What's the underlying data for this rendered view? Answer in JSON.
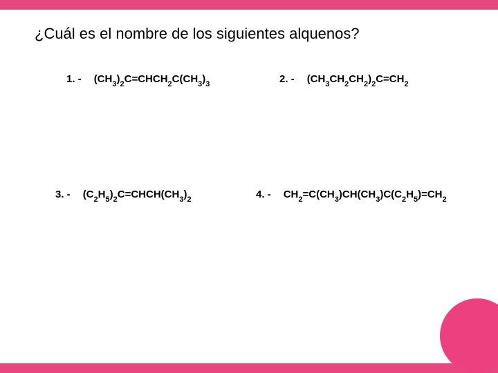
{
  "title": "¿Cuál es el nombre de los siguientes alquenos?",
  "items": {
    "i1": {
      "num": "1. -",
      "formula": "(CH<sub>3</sub>)<sub>2</sub>C=CHCH<sub>2</sub>C(CH<sub>3</sub>)<sub>3</sub>"
    },
    "i2": {
      "num": "2. -",
      "formula": "(CH<sub>3</sub>CH<sub>2</sub>CH<sub>2</sub>)<sub>2</sub>C=CH<sub>2</sub>"
    },
    "i3": {
      "num": "3. -",
      "formula": "(C<sub>2</sub>H<sub>5</sub>)<sub>2</sub>C=CHCH(CH<sub>3</sub>)<sub>2</sub>"
    },
    "i4": {
      "num": "4. -",
      "formula": "CH<sub>2</sub>=C(CH<sub>3</sub>)CH(CH<sub>3</sub>)C(C<sub>2</sub>H<sub>5</sub>)=CH<sub>2</sub>"
    }
  }
}
